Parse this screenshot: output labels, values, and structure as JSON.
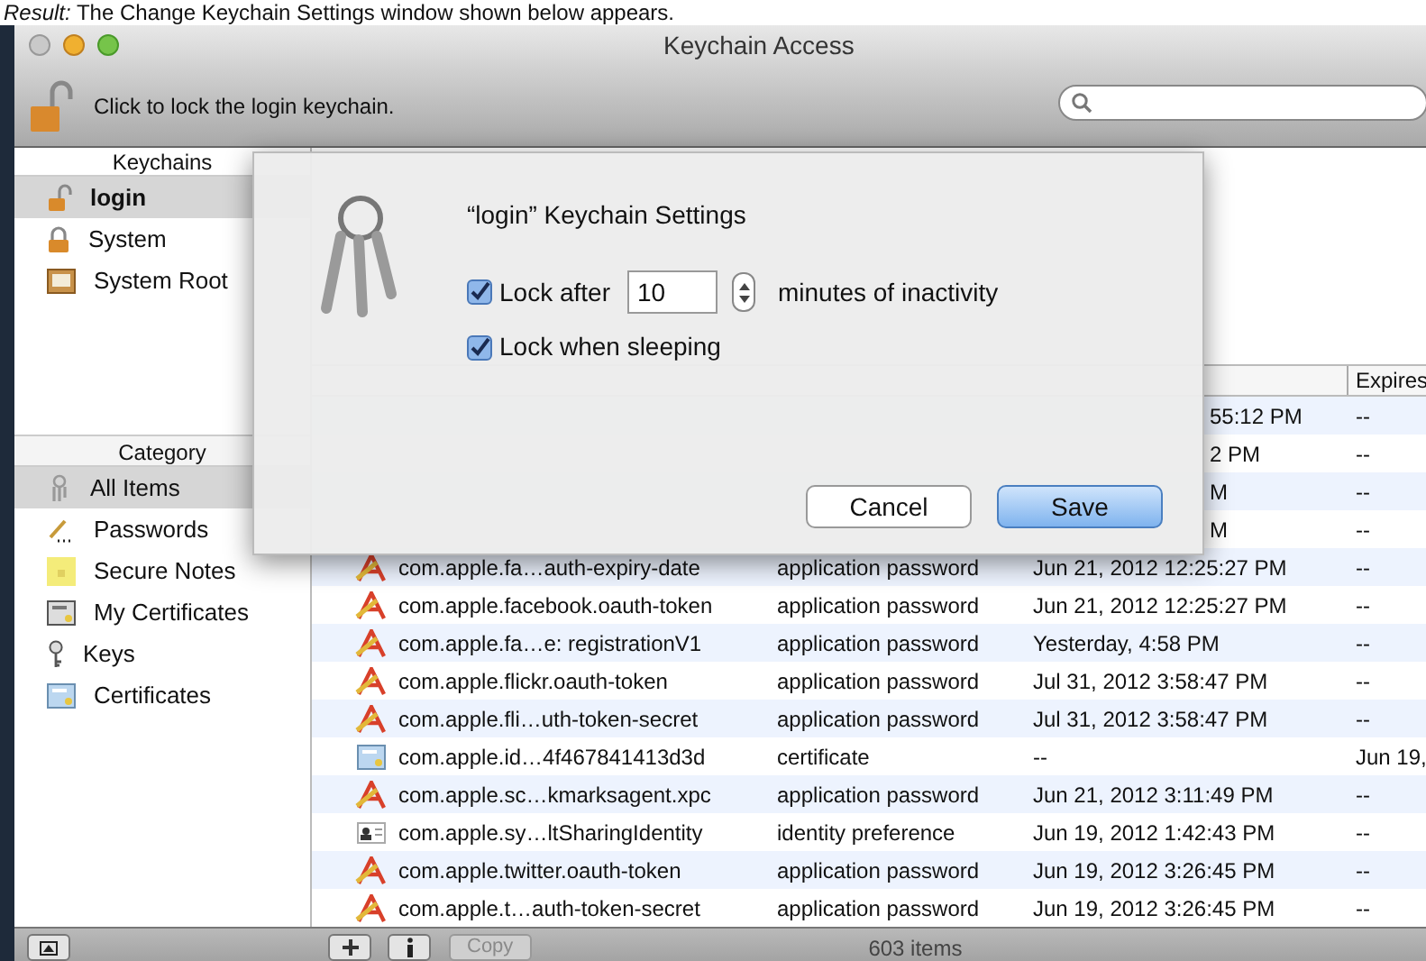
{
  "caption": "*Result:* The Change Keychain Settings window shown below appears.",
  "window": {
    "title": "Keychain Access"
  },
  "toolbar": {
    "lock_label": "Click to lock the login keychain."
  },
  "keychains": {
    "header": "Keychains",
    "items": [
      {
        "label": "login",
        "kind": "unlocked",
        "selected": true
      },
      {
        "label": "System",
        "kind": "locked",
        "selected": false
      },
      {
        "label": "System Root",
        "kind": "roots",
        "selected": false
      }
    ]
  },
  "category": {
    "header": "Category",
    "items": [
      {
        "label": "All Items",
        "kind": "keys",
        "selected": true
      },
      {
        "label": "Passwords",
        "kind": "pencil",
        "selected": false
      },
      {
        "label": "Secure Notes",
        "kind": "note",
        "selected": false
      },
      {
        "label": "My Certificates",
        "kind": "mycert",
        "selected": false
      },
      {
        "label": "Keys",
        "kind": "key",
        "selected": false
      },
      {
        "label": "Certificates",
        "kind": "cert",
        "selected": false
      }
    ]
  },
  "table": {
    "columns": [
      "Expires"
    ],
    "rows": [
      {
        "kind": "partial",
        "date_modified": "55:12 PM",
        "expires": "--"
      },
      {
        "kind": "partial",
        "date_modified": "2 PM",
        "expires": "--"
      },
      {
        "kind": "partial",
        "date_modified": "M",
        "expires": "--"
      },
      {
        "kind": "partial",
        "date_modified": "M",
        "expires": "--"
      },
      {
        "kind": "app",
        "name": "com.apple.fa…auth-expiry-date",
        "type": "application password",
        "date_modified": "Jun 21, 2012 12:25:27 PM",
        "expires": "--"
      },
      {
        "kind": "app",
        "name": "com.apple.facebook.oauth-token",
        "type": "application password",
        "date_modified": "Jun 21, 2012 12:25:27 PM",
        "expires": "--"
      },
      {
        "kind": "app",
        "name": "com.apple.fa…e: registrationV1",
        "type": "application password",
        "date_modified": "Yesterday, 4:58 PM",
        "expires": "--"
      },
      {
        "kind": "app",
        "name": "com.apple.flickr.oauth-token",
        "type": "application password",
        "date_modified": "Jul 31, 2012 3:58:47 PM",
        "expires": "--"
      },
      {
        "kind": "app",
        "name": "com.apple.fli…uth-token-secret",
        "type": "application password",
        "date_modified": "Jul 31, 2012 3:58:47 PM",
        "expires": "--"
      },
      {
        "kind": "cert",
        "name": "com.apple.id…4f467841413d3d",
        "type": "certificate",
        "date_modified": "--",
        "expires": "Jun 19,"
      },
      {
        "kind": "app",
        "name": "com.apple.sc…kmarksagent.xpc",
        "type": "application password",
        "date_modified": "Jun 21, 2012 3:11:49 PM",
        "expires": "--"
      },
      {
        "kind": "identity",
        "name": "com.apple.sy…ltSharingIdentity",
        "type": "identity preference",
        "date_modified": "Jun 19, 2012 1:42:43 PM",
        "expires": "--"
      },
      {
        "kind": "app",
        "name": "com.apple.twitter.oauth-token",
        "type": "application password",
        "date_modified": "Jun 19, 2012 3:26:45 PM",
        "expires": "--"
      },
      {
        "kind": "app",
        "name": "com.apple.t…auth-token-secret",
        "type": "application password",
        "date_modified": "Jun 19, 2012 3:26:45 PM",
        "expires": "--"
      }
    ]
  },
  "status_bar": {
    "copy": {
      "label": "Copy",
      "disabled": true
    },
    "count": "603 items"
  },
  "dialog": {
    "title": "“login” Keychain Settings",
    "lock_after": {
      "label": "Lock after",
      "checked": true,
      "value": "10",
      "suffix": "minutes of inactivity"
    },
    "lock_sleep": {
      "label": "Lock when sleeping",
      "checked": true
    },
    "buttons": [
      {
        "label": "Cancel",
        "default": false
      },
      {
        "label": "Save",
        "default": true
      }
    ]
  }
}
